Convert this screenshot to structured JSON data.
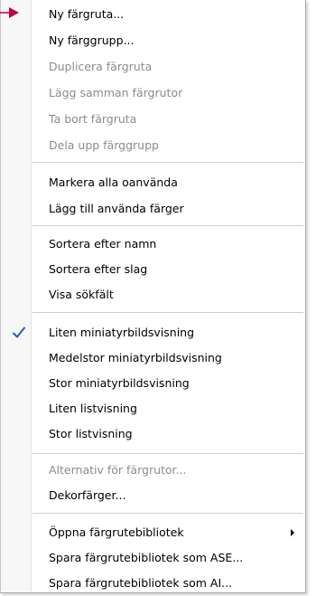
{
  "menu": {
    "groups": [
      {
        "items": [
          {
            "label": "Ny färgruta...",
            "enabled": true
          },
          {
            "label": "Ny färggrupp...",
            "enabled": true
          },
          {
            "label": "Duplicera färgruta",
            "enabled": false
          },
          {
            "label": "Lägg samman färgrutor",
            "enabled": false
          },
          {
            "label": "Ta bort färgruta",
            "enabled": false
          },
          {
            "label": "Dela upp färggrupp",
            "enabled": false
          }
        ]
      },
      {
        "items": [
          {
            "label": "Markera alla oanvända",
            "enabled": true
          },
          {
            "label": "Lägg till använda färger",
            "enabled": true
          }
        ]
      },
      {
        "items": [
          {
            "label": "Sortera efter namn",
            "enabled": true
          },
          {
            "label": "Sortera efter slag",
            "enabled": true
          },
          {
            "label": "Visa sökfält",
            "enabled": true
          }
        ]
      },
      {
        "items": [
          {
            "label": "Liten miniatyrbildsvisning",
            "enabled": true,
            "checked": true
          },
          {
            "label": "Medelstor miniatyrbildsvisning",
            "enabled": true
          },
          {
            "label": "Stor miniatyrbildsvisning",
            "enabled": true
          },
          {
            "label": "Liten listvisning",
            "enabled": true
          },
          {
            "label": "Stor listvisning",
            "enabled": true
          }
        ]
      },
      {
        "items": [
          {
            "label": "Alternativ för färgrutor...",
            "enabled": false
          },
          {
            "label": "Dekorfärger...",
            "enabled": true
          }
        ]
      },
      {
        "items": [
          {
            "label": "Öppna färgrutebibliotek",
            "enabled": true,
            "submenu": true
          },
          {
            "label": "Spara färgrutebibliotek som ASE...",
            "enabled": true
          },
          {
            "label": "Spara färgrutebibliotek som AI...",
            "enabled": true
          }
        ]
      }
    ]
  },
  "icons": {
    "check": "checkmark-icon",
    "submenu": "submenu-arrow-icon",
    "pointer": "callout-arrow-icon"
  },
  "colors": {
    "check": "#2a5db0",
    "pointer": "#c0003c",
    "disabled_text": "#8c8c8c",
    "text": "#000000"
  }
}
